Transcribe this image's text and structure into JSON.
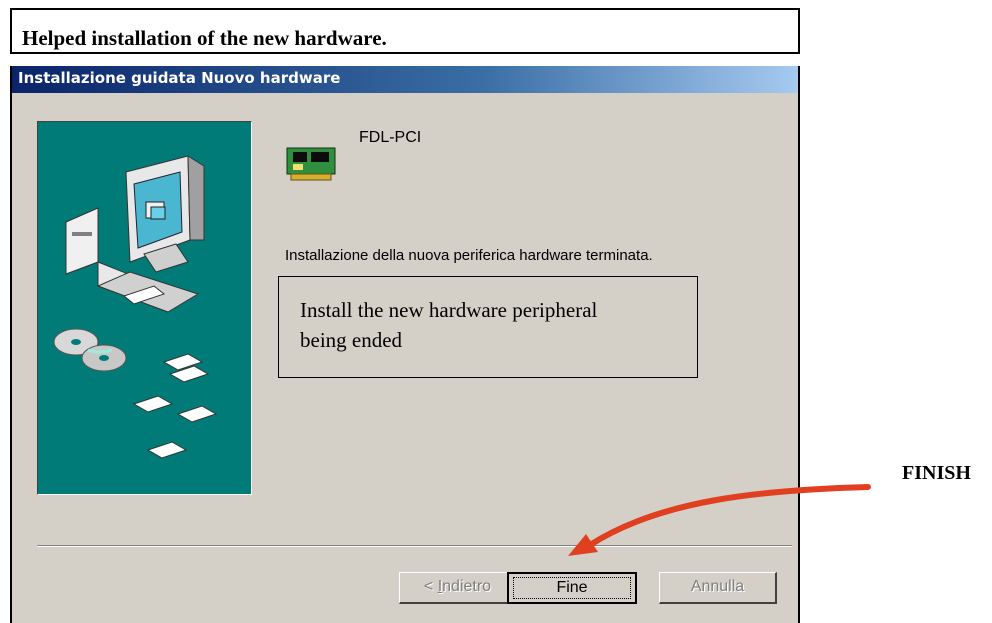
{
  "caption": {
    "text": "Helped installation of the new hardware."
  },
  "dialog": {
    "title": "Installazione guidata Nuovo hardware",
    "device_name": "FDL-PCI",
    "status_text": "Installazione della nuova periferica hardware terminata.",
    "buttons": {
      "back_prefix": "< ",
      "back_accel": "I",
      "back_rest": "ndietro",
      "finish": "Fine",
      "cancel": "Annulla"
    }
  },
  "annotation": {
    "text": "Install the new hardware peripheral being ended"
  },
  "callout": {
    "label": "FINISH",
    "arrow_color": "#e04020"
  },
  "colors": {
    "dialog_bg": "#d4d0c8",
    "art_panel": "#007b78",
    "title_gradient_start": "#0a246a",
    "title_gradient_end": "#a6caf0"
  },
  "icons": [
    "computer-icon",
    "cd-icon",
    "floppy-icon",
    "pci-card-icon",
    "arrow-icon"
  ]
}
